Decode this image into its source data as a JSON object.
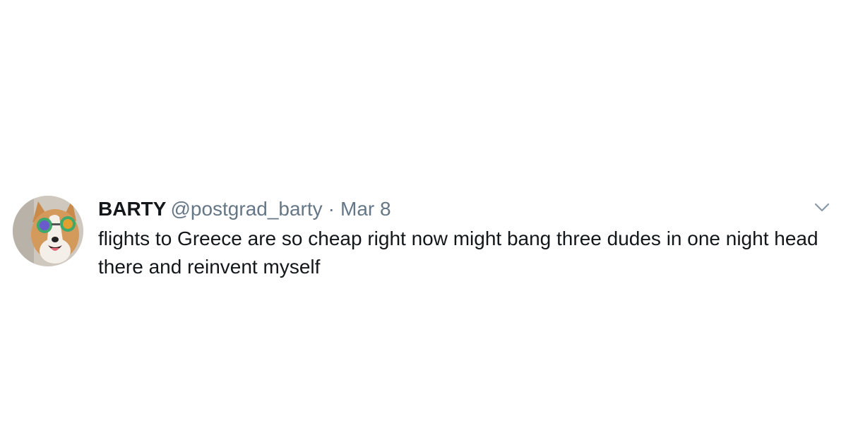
{
  "tweet": {
    "display_name": "BARTY",
    "handle": "@postgrad_barty",
    "separator": "·",
    "date": "Mar 8",
    "text": "flights to Greece are so cheap right now might bang three dudes in one night head there and reinvent myself",
    "avatar_icon": "corgi-with-sunglasses-avatar",
    "menu_icon": "chevron-down-icon"
  },
  "colors": {
    "text": "#14171a",
    "secondary": "#657786",
    "background": "#ffffff"
  }
}
